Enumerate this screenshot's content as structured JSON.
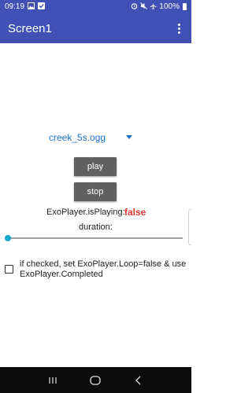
{
  "status_bar": {
    "time": "09:19",
    "battery": "100%",
    "left_icons": [
      "image-icon",
      "check-icon"
    ],
    "right_icons": [
      "alarm-icon",
      "mute-icon",
      "airplane-icon",
      "battery-icon"
    ]
  },
  "app_bar": {
    "title": "Screen1",
    "color": "#3f51b5"
  },
  "player": {
    "spinner_value": "creek_5s.ogg",
    "play_label": "play",
    "stop_label": "stop",
    "isplaying_label": "ExoPlayer.isPlaying:",
    "isplaying_value": "false",
    "isplaying_value_color": "#e53935",
    "duration_label": "duration:",
    "slider_position": 0
  },
  "loop_option": {
    "checked": false,
    "label": "if checked, set ExoPlayer.Loop=false & use\nExoPlayer.Completed"
  },
  "nav_bar": {
    "buttons": [
      "recents-icon",
      "home-icon",
      "back-icon"
    ]
  }
}
